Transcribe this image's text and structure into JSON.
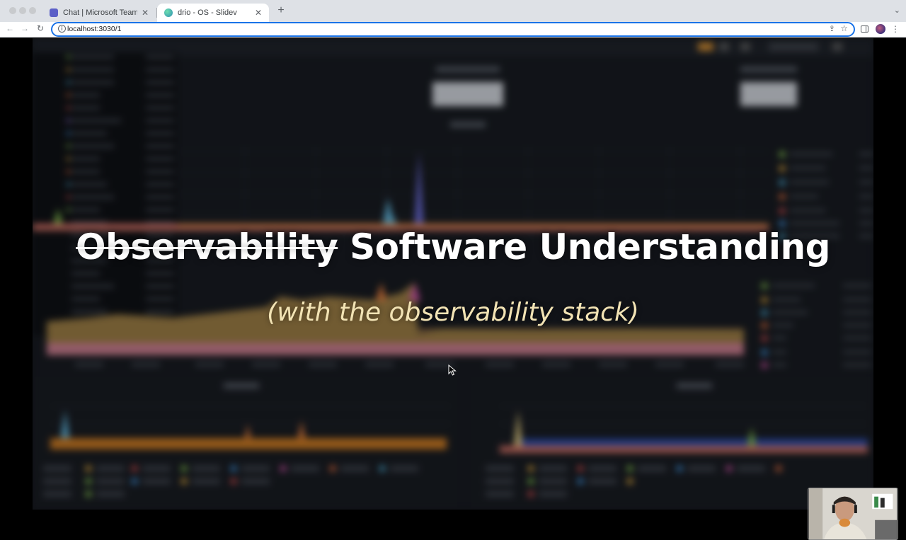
{
  "browser": {
    "tabs": [
      {
        "label": "Chat | Microsoft Teams",
        "favicon": "teams-icon",
        "active": false
      },
      {
        "label": "drio - OS - Slidev",
        "favicon": "slidev-icon",
        "active": true
      }
    ],
    "url": "localhost:3030/1"
  },
  "slide": {
    "title_struck": "Observability",
    "title_rest": "Software Understanding",
    "subtitle": "(with the observability stack)"
  },
  "colors": {
    "omnibox_focus": "#1a73e8",
    "title": "#ffffff",
    "subtitle": "#f2e3b4",
    "slide_background": "#131519"
  }
}
